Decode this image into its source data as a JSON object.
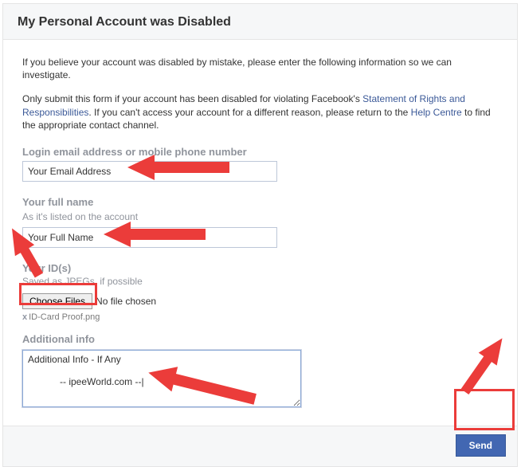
{
  "header": {
    "title": "My Personal Account was Disabled"
  },
  "intro": {
    "p1": "If you believe your account was disabled by mistake, please enter the following information so we can investigate.",
    "p2a": "Only submit this form if your account has been disabled for violating Facebook's ",
    "link1": "Statement of Rights and Responsibilities",
    "p2b": ". If you can't access your account for a different reason, please return to the ",
    "link2": "Help Centre",
    "p2c": " to find the appropriate contact channel."
  },
  "fields": {
    "email_label": "Login email address or mobile phone number",
    "email_value": "Your Email Address",
    "name_label": "Your full name",
    "name_sub": "As it's listed on the account",
    "name_value": "Your Full Name",
    "ids_label": "Your ID(s)",
    "ids_sub": "Saved as JPEGs, if possible",
    "file_button": "Choose Files",
    "file_status": "No file chosen",
    "file_remove_x": "x",
    "file_chosen": "ID-Card Proof.png",
    "addl_label": "Additional info",
    "addl_value": "Additional Info - If Any\n\n            -- ipeeWorld.com --|"
  },
  "footer": {
    "send": "Send"
  }
}
